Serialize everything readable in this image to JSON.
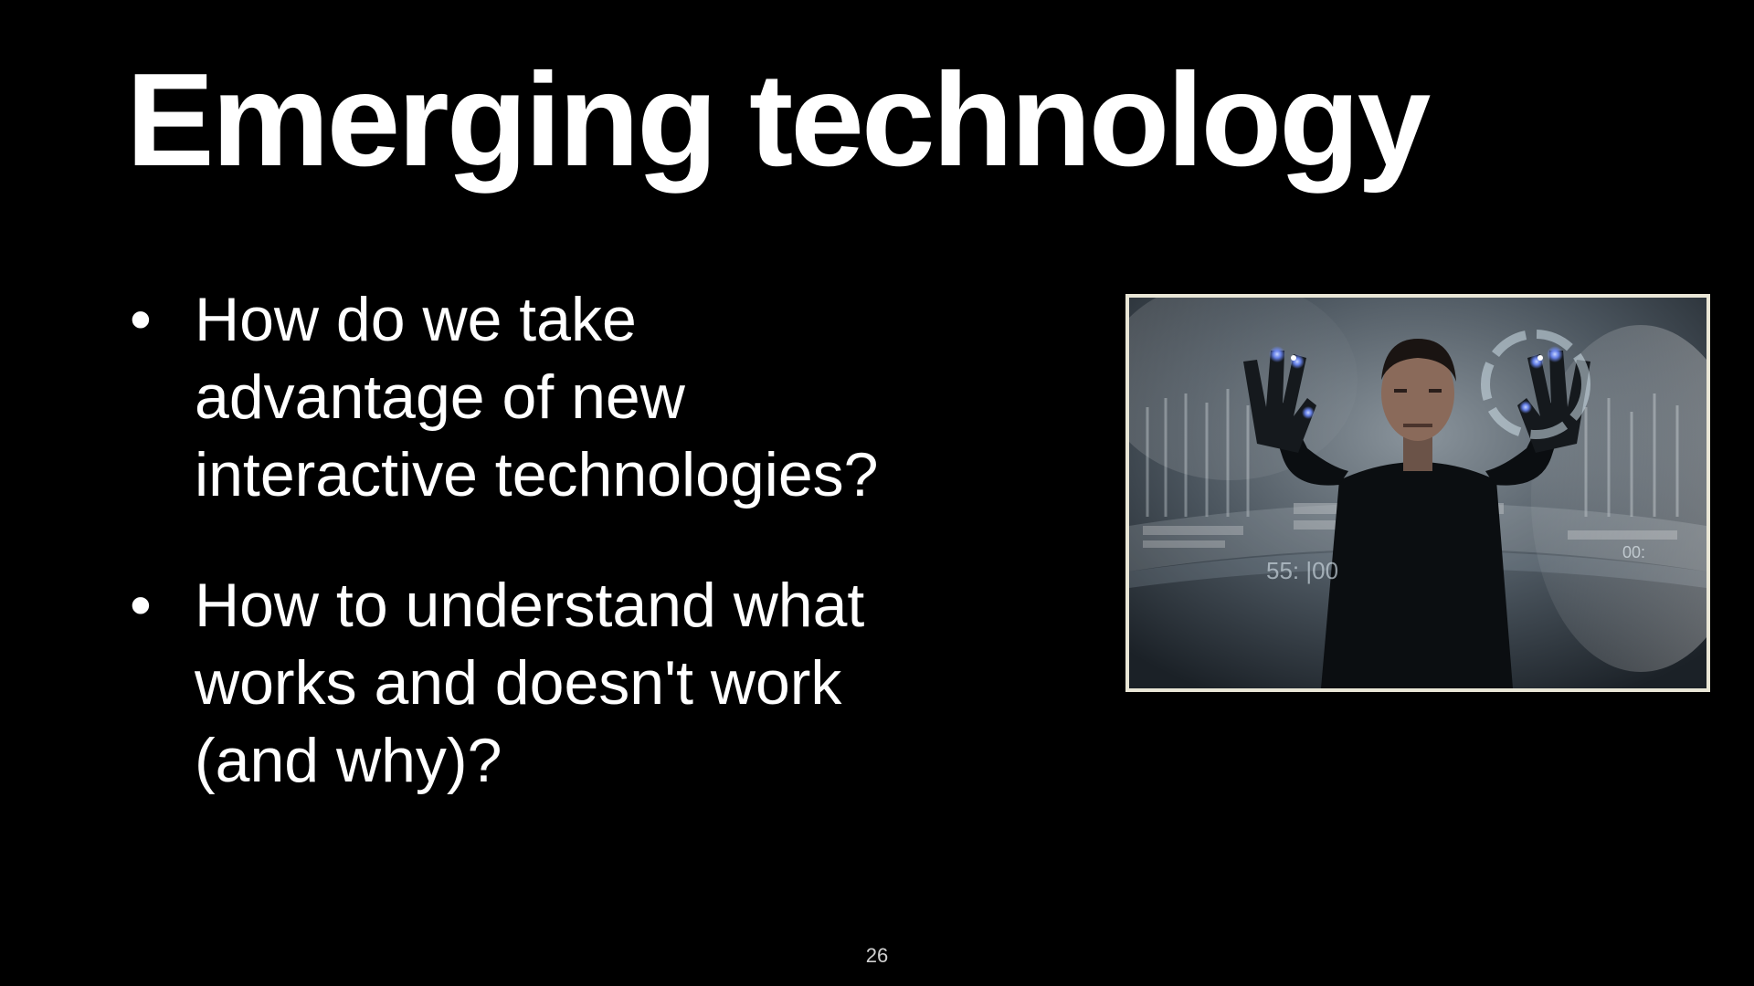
{
  "slide": {
    "title": "Emerging technology",
    "bullets": [
      {
        "marker": "•",
        "text": "How do we take\nadvantage of new\ninteractive technologies?"
      },
      {
        "marker": "•",
        "text": "How to understand what\nworks and doesn't work\n(and why)?"
      }
    ],
    "page_number": "26"
  },
  "image": {
    "readout_left": "55: |00",
    "readout_right": "00:",
    "colors": {
      "frame": "#e9e6d6",
      "glow": "#6f8cff"
    }
  }
}
